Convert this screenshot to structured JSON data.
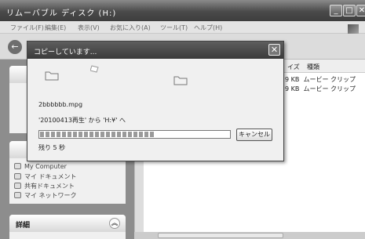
{
  "window": {
    "title": "リムーバブル ディスク (H:)"
  },
  "menu": [
    "ファイル(F)",
    "編集(E)",
    "表示(V)",
    "お気に入り(A)",
    "ツール(T)",
    "ヘルプ(H)"
  ],
  "panels": {
    "other": {
      "links": [
        "My Computer",
        "マイ ドキュメント",
        "共有ドキュメント",
        "マイ ネットワーク"
      ]
    },
    "details": {
      "title": "詳細"
    }
  },
  "columns": {
    "size": "イズ",
    "type": "種類"
  },
  "rows": [
    {
      "size": "9 KB",
      "type": "ムービー クリップ"
    },
    {
      "size": "9 KB",
      "type": "ムービー クリップ"
    }
  ],
  "dialog": {
    "title": "コピーしています...",
    "filename": "2bbbbbb.mpg",
    "route": "'20100413再生' から 'H:¥' へ",
    "remaining": "残り 5 秒",
    "cancel": "キャンセル",
    "progress": 0.6
  }
}
